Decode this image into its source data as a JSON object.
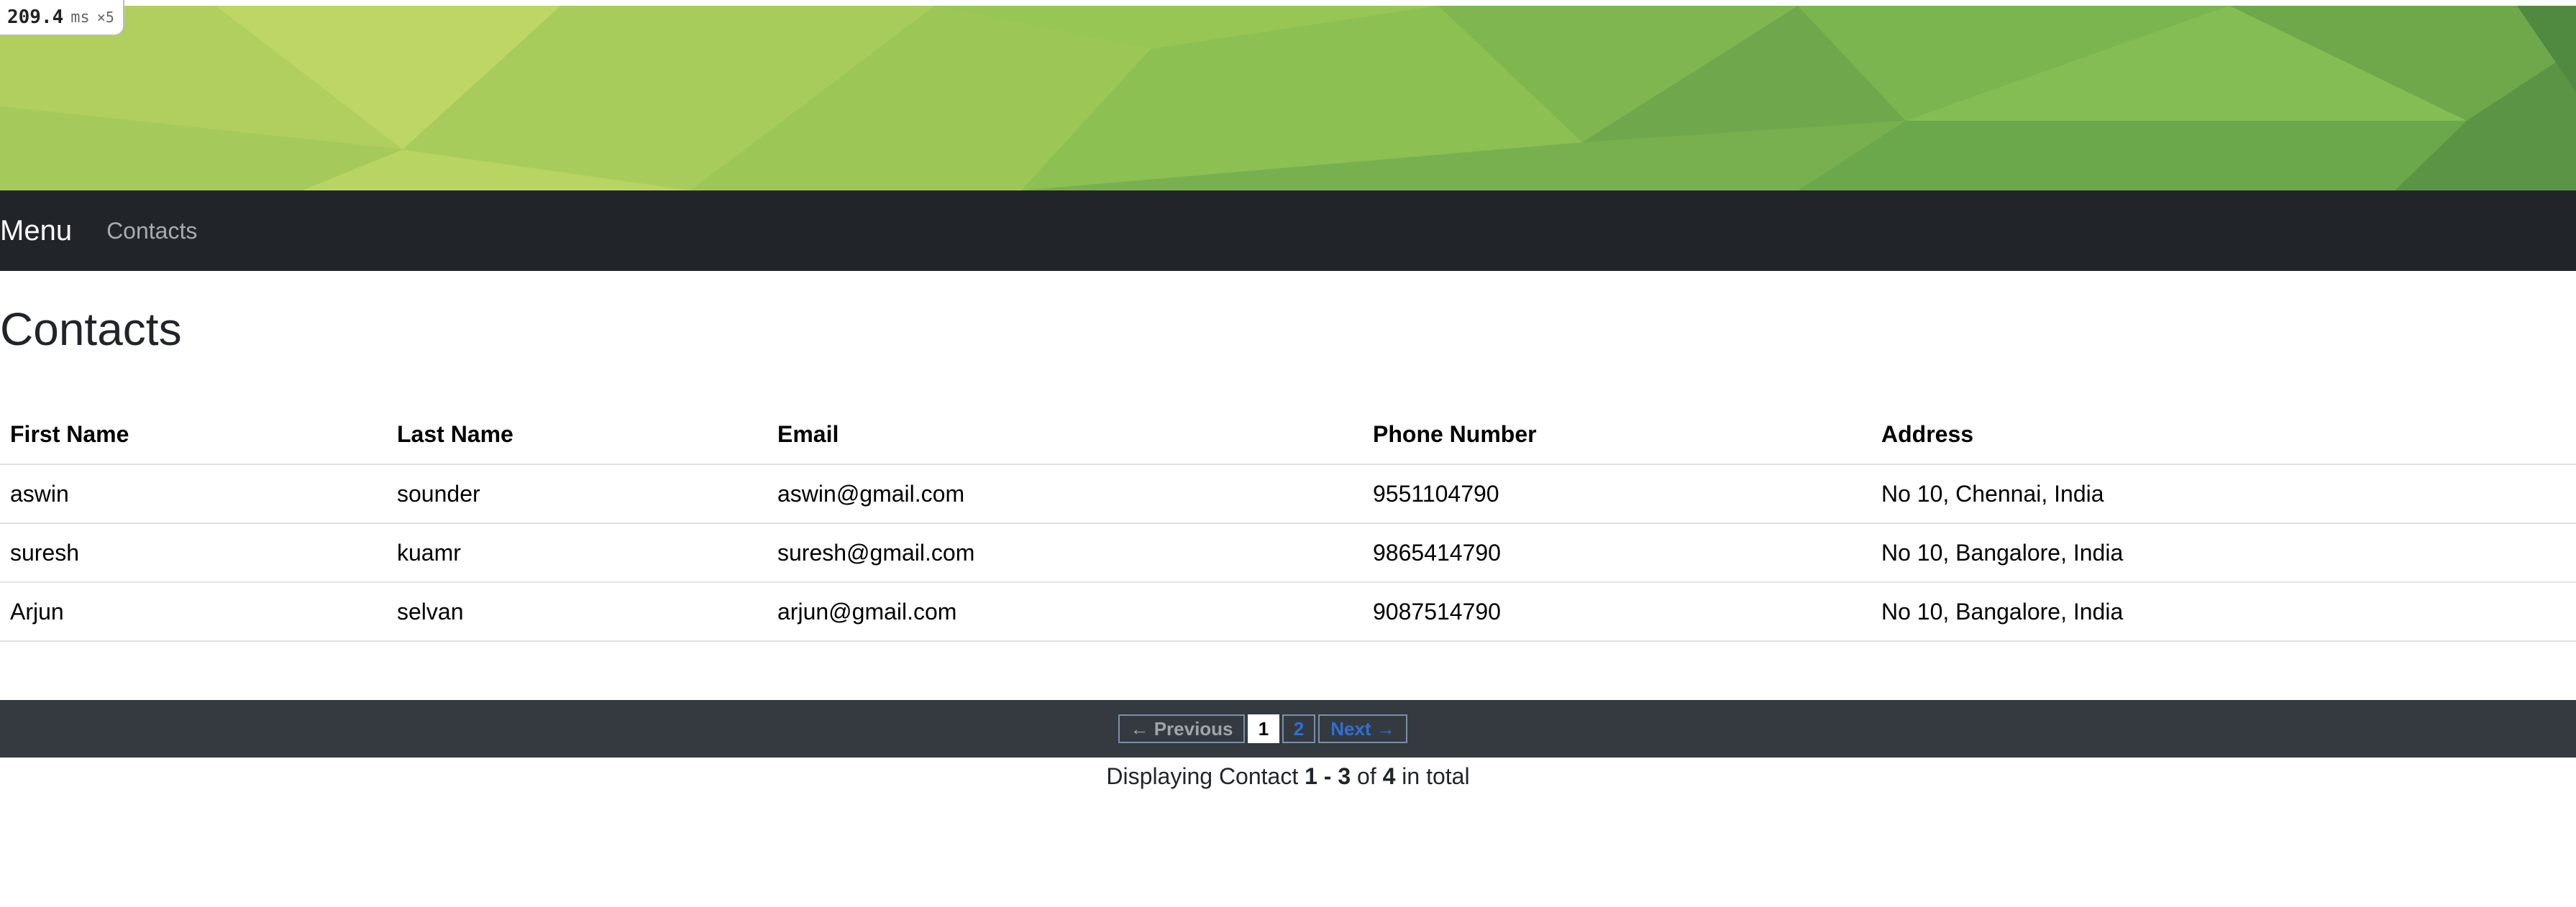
{
  "profiler": {
    "time": "209.4",
    "unit": "ms",
    "count": "×5"
  },
  "navbar": {
    "brand": "Menu",
    "link": "Contacts"
  },
  "page": {
    "title": "Contacts"
  },
  "table": {
    "headers": [
      "First Name",
      "Last Name",
      "Email",
      "Phone Number",
      "Address"
    ],
    "rows": [
      [
        "aswin",
        "sounder",
        "aswin@gmail.com",
        "9551104790",
        "No 10, Chennai, India"
      ],
      [
        "suresh",
        "kuamr",
        "suresh@gmail.com",
        "9865414790",
        "No 10, Bangalore, India"
      ],
      [
        "Arjun",
        "selvan",
        "arjun@gmail.com",
        "9087514790",
        "No 10, Bangalore, India"
      ]
    ]
  },
  "pagination": {
    "previous": "← Previous",
    "pages": [
      "1",
      "2"
    ],
    "current_page": "1",
    "next": "Next →"
  },
  "summary": {
    "prefix": "Displaying Contact",
    "range": "1 - 3",
    "of": "of",
    "total": "4",
    "suffix": "in total"
  },
  "colors": {
    "banner_base": "#8fc04f",
    "navbar_bg": "#212529",
    "pager_bg": "#343a40",
    "link": "#2f6fd6"
  }
}
